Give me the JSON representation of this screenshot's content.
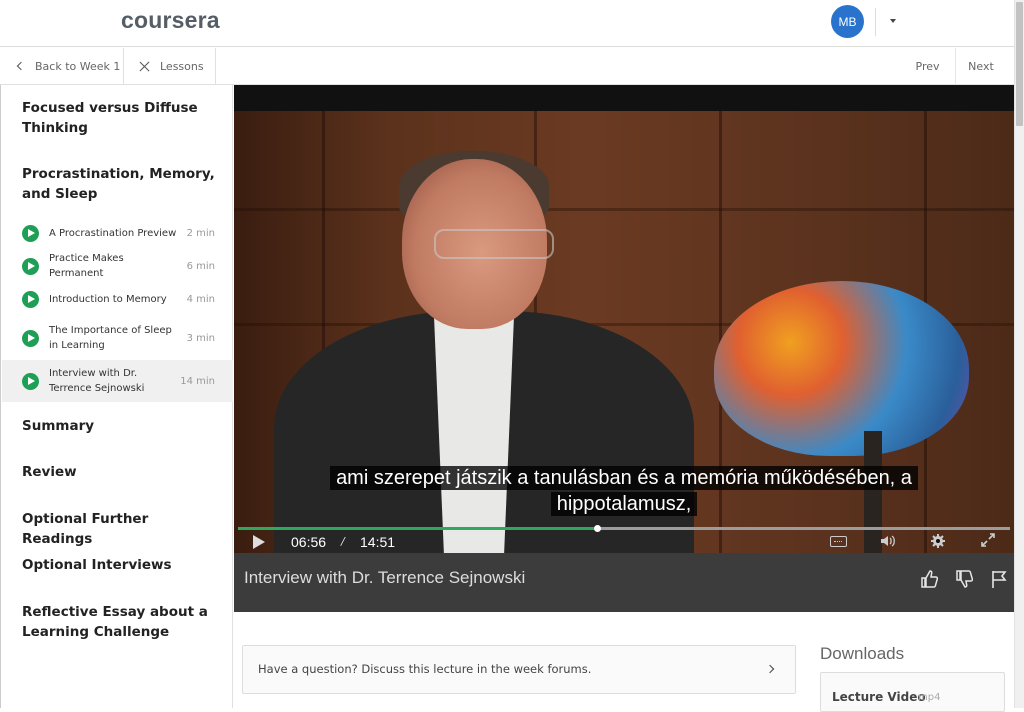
{
  "header": {
    "logo_text": "coursera",
    "avatar_initials": "MB"
  },
  "subnav": {
    "back_label": "Back to Week 1",
    "lessons_label": "Lessons",
    "prev_label": "Prev",
    "next_label": "Next"
  },
  "sidebar": {
    "sections": [
      {
        "title": "Focused versus Diffuse Thinking"
      },
      {
        "title": "Procrastination, Memory, and Sleep"
      },
      {
        "title": "Summary"
      },
      {
        "title": "Review"
      },
      {
        "title": "Optional Further Readings"
      },
      {
        "title": "Optional Interviews"
      },
      {
        "title": "Reflective Essay about a Learning Challenge"
      }
    ],
    "lessons": [
      {
        "title": "A Procrastination Preview",
        "duration": "2 min"
      },
      {
        "title": "Practice Makes Permanent",
        "duration": "6 min"
      },
      {
        "title": "Introduction to Memory",
        "duration": "4 min"
      },
      {
        "title": "The Importance of Sleep in Learning",
        "duration": "3 min"
      },
      {
        "title": "Interview with Dr. Terrence Sejnowski",
        "duration": "14 min",
        "active": true
      }
    ]
  },
  "video": {
    "subtitle_line1": "ami szerepet játszik a tanulásban és a memória működésében, a",
    "subtitle_line2": "hippotalamusz,",
    "current_time": "06:56",
    "separator": "/",
    "total_time": "14:51",
    "progress": 0.465,
    "title": "Interview with Dr. Terrence Sejnowski",
    "accent_color": "#2ea85c"
  },
  "content": {
    "question_text": "Have a question? Discuss this lecture in the week forums.",
    "downloads_title": "Downloads",
    "download_label": "Lecture Video",
    "download_format": "mp4"
  }
}
